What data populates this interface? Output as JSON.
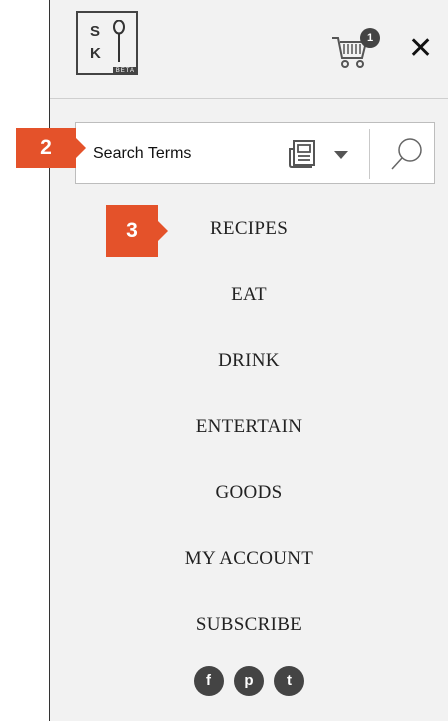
{
  "logo": {
    "letters_top": "S",
    "letters_bottom": "K",
    "beta": "BETA"
  },
  "cart": {
    "count": "1"
  },
  "close_label": "✕",
  "search": {
    "placeholder": "Search Terms"
  },
  "nav": {
    "items": [
      {
        "label": "RECIPES"
      },
      {
        "label": "EAT"
      },
      {
        "label": "DRINK"
      },
      {
        "label": "ENTERTAIN"
      },
      {
        "label": "GOODS"
      },
      {
        "label": "MY ACCOUNT"
      },
      {
        "label": "SUBSCRIBE"
      }
    ]
  },
  "social": {
    "facebook": "f",
    "pinterest": "p",
    "twitter": "t"
  },
  "markers": {
    "step_2": "2",
    "step_3": "3"
  },
  "colors": {
    "marker": "#e4522a",
    "panel": "#f2f2f2"
  }
}
